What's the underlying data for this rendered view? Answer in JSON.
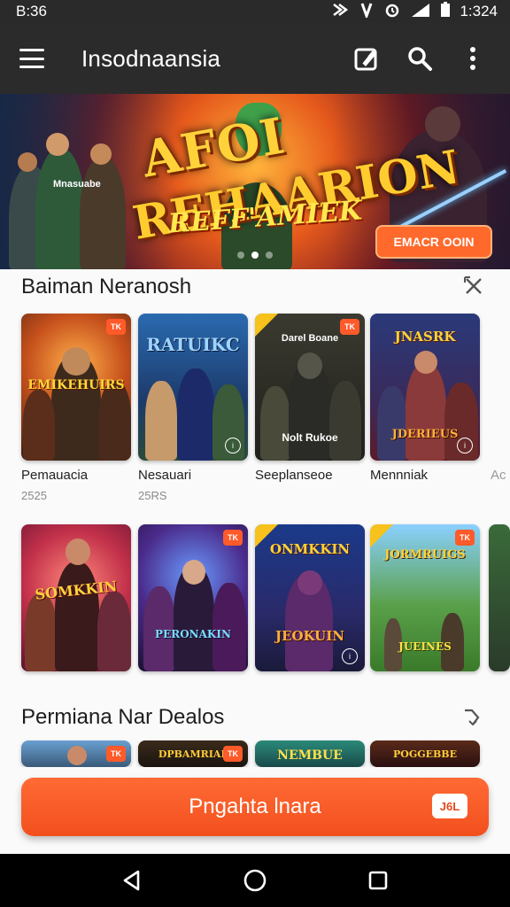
{
  "status": {
    "time": "B:36",
    "clock_right": "1:324"
  },
  "appbar": {
    "title": "Insodnaansia"
  },
  "banner": {
    "title_line1": "AFOI",
    "title_line2": "REHAARION",
    "title_line3": "REFF'AMIEK",
    "small_text": "Mnasuabe",
    "cta_label": "EMACR OOIN"
  },
  "section1": {
    "title": "Baiman Neranosh",
    "cards": [
      {
        "logo": "EMIKEHUIRS",
        "label": "Pemauacia",
        "sub": "2525",
        "badge": "TK"
      },
      {
        "logo": "RATUIKC",
        "label": "Nesauari",
        "sub": "25RS",
        "badge": ""
      },
      {
        "logo": "Nolt Rukoe",
        "top_text": "Darel Boane",
        "label": "Seeplanseoe",
        "sub": "",
        "badge": "TK"
      },
      {
        "logo": "JDERIEUS",
        "top_text": "JNASRK",
        "label": "Mennniak",
        "sub": "",
        "badge": ""
      }
    ],
    "overflow_label": "Ac"
  },
  "row2": {
    "cards": [
      {
        "logo": "SOMKKIN"
      },
      {
        "logo": "PERONAKIN"
      },
      {
        "logo": "JEOKUIN",
        "top_text": "ONMKKIN"
      },
      {
        "logo": "JUEINES",
        "top_text": "JORMRUIGS"
      }
    ]
  },
  "section2": {
    "title": "Permiana Nar Dealos",
    "cards": [
      {
        "logo": ""
      },
      {
        "logo": "DPBAMRIAL"
      },
      {
        "logo": "NEMBUE"
      },
      {
        "logo": "POGGEBBE"
      }
    ]
  },
  "main_button": {
    "label": "Pngahta lnara",
    "tag": "J6L"
  },
  "colors": {
    "accent": "#f2501e",
    "appbar": "#2b2b2b",
    "nav": "#000000"
  }
}
